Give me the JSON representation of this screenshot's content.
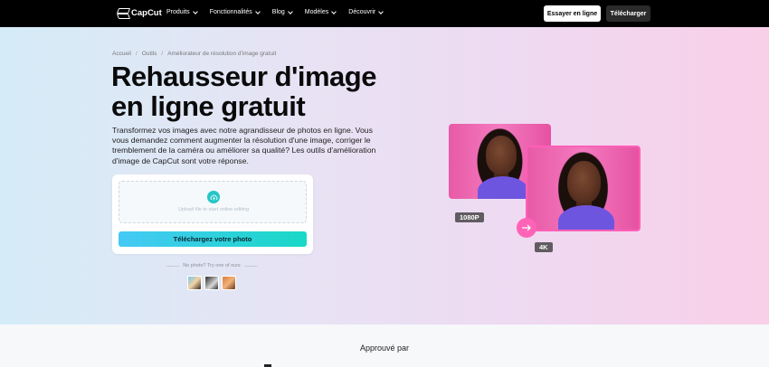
{
  "nav": {
    "brand": "CapCut",
    "menu": [
      {
        "label": "Produits"
      },
      {
        "label": "Fonctionnalités"
      },
      {
        "label": "Blog"
      },
      {
        "label": "Modèles"
      },
      {
        "label": "Découvrir"
      }
    ],
    "try_label": "Essayer en ligne",
    "download_label": "Télécharger"
  },
  "breadcrumb": {
    "items": [
      "Accueil",
      "Outils",
      "Améliorateur de résolution d'image gratuit"
    ],
    "separator": "/"
  },
  "hero": {
    "title": "Rehausseur d'image en ligne gratuit",
    "description": "Transformez vos images avec notre agrandisseur de photos en ligne. Vous vous demandez comment augmenter la résolution d'une image, corriger le tremblement de la caméra ou améliorer sa qualité? Les outils d'amélioration d'image de CapCut sont votre réponse."
  },
  "upload": {
    "drop_text": "Upload file to start online editing",
    "button_label": "Téléchargez votre photo",
    "no_photo_text": "No photo? Try one of ours"
  },
  "compare": {
    "before_label": "1080P",
    "after_label": "4K"
  },
  "approved": {
    "label": "Approuvé par"
  },
  "colors": {
    "accent_pink": "#ff63b8",
    "upload_gradient_start": "#45c9f5",
    "upload_gradient_end": "#19d8c6"
  }
}
